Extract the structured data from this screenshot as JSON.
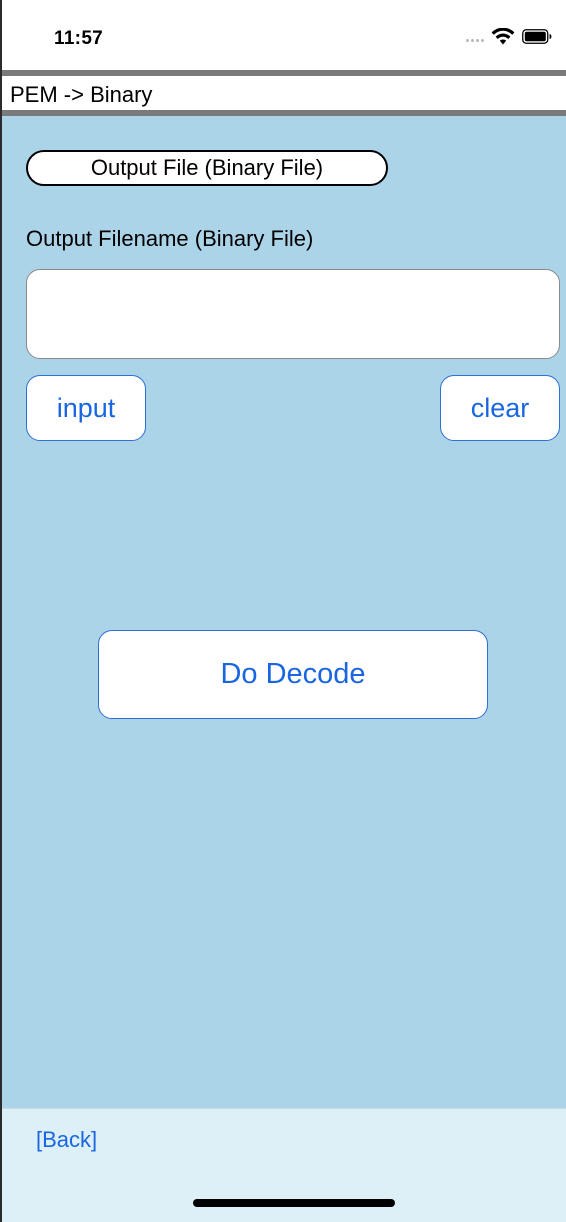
{
  "status_bar": {
    "time": "11:57",
    "icons": [
      "cellular-signal-icon",
      "wifi-icon",
      "battery-icon"
    ]
  },
  "header": {
    "title": "PEM -> Binary"
  },
  "main": {
    "section_label": "Output File (Binary File)",
    "field_label": "Output Filename (Binary File)",
    "filename_value": "",
    "filename_placeholder": "",
    "input_button_label": "input",
    "clear_button_label": "clear",
    "decode_button_label": "Do Decode"
  },
  "toolbar": {
    "back_label": "[Back]"
  },
  "colors": {
    "content_background": "#acd4e9",
    "toolbar_background": "#def0f7",
    "button_text": "#1a66e0",
    "header_rule": "#7a7a7a"
  }
}
